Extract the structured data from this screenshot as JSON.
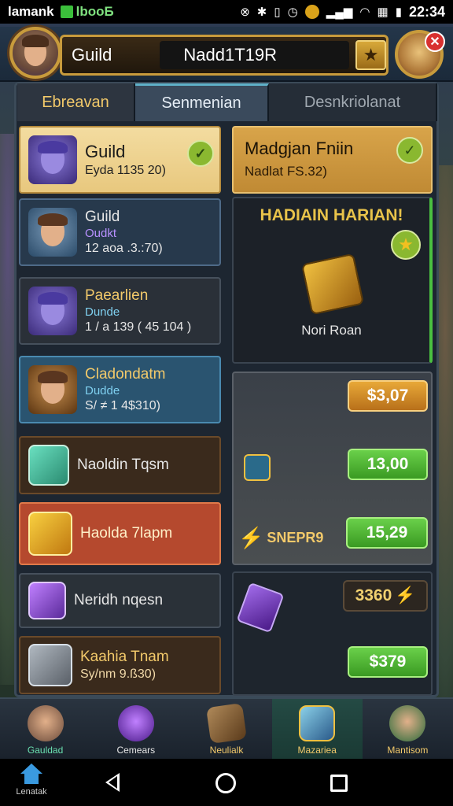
{
  "status_bar": {
    "carrier": "lamank",
    "app_label": "lbooБ",
    "time": "22:34",
    "icons": [
      "notification-icon",
      "bluetooth-icon",
      "vibrate-icon",
      "alarm-icon",
      "coin-icon",
      "signal-icon",
      "wifi-icon",
      "sim-icon",
      "battery-icon"
    ]
  },
  "header": {
    "guild_label": "Guild",
    "guild_name": "Nadd1T19R",
    "close_symbol": "✕",
    "star_symbol": "★"
  },
  "tabs": [
    {
      "label": "Ebreavan",
      "active": false
    },
    {
      "label": "Senmenian",
      "active": true
    },
    {
      "label": "Desnkriolanat",
      "active": false
    }
  ],
  "guild_list": [
    {
      "name": "Guild",
      "sub": "",
      "stat": "Eyda 1135 20)",
      "badge": "check"
    },
    {
      "name": "Guild",
      "sub": "Oudkt",
      "stat": "12 aoa .3.:70)"
    },
    {
      "name": "Paearlien",
      "sub": "Dunde",
      "stat": "1 / a 139 ( 45 104 )"
    },
    {
      "name": "Cladondatm",
      "sub": "Dudde",
      "stat": "S/ ≠ 1 4$310)"
    },
    {
      "name": "Naoldin Tqsm",
      "sub": "",
      "stat": ""
    },
    {
      "name": "Haolda 7lapm",
      "sub": "",
      "stat": ""
    },
    {
      "name": "Neridh nqesn",
      "sub": "",
      "stat": ""
    },
    {
      "name": "Kaahia Tnam",
      "sub": "",
      "stat": "Sy/nm 9.ß30)"
    }
  ],
  "right_panel": {
    "header_title": "Madgjan Fniin",
    "header_sub": "Nadlat FS.32)",
    "feature_title": "HADIAIN HARIAN!",
    "feature_item": "Nori Roan",
    "bolt_label": "SNEPR9",
    "prices": [
      "$3,07",
      "13,00",
      "15,29",
      "3360",
      "$379"
    ]
  },
  "bottom_nav": [
    {
      "label": "Gauldad",
      "active": false
    },
    {
      "label": "Cemears",
      "active": false
    },
    {
      "label": "Neulialk",
      "active": false
    },
    {
      "label": "Mazariea",
      "active": true
    },
    {
      "label": "Mantisom",
      "active": false
    }
  ],
  "system_nav": {
    "home_app_label": "Lenatak"
  },
  "colors": {
    "accent_gold": "#c89b3c",
    "buy_green": "#3a9a22",
    "tab_active": "#3a4a5c"
  }
}
